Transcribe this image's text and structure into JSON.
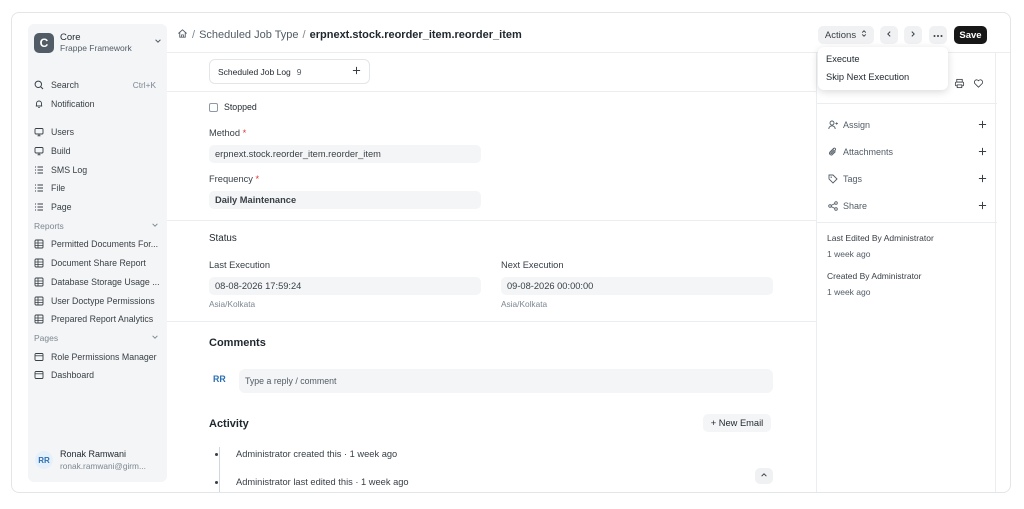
{
  "app": {
    "logo_letter": "C",
    "name": "Core",
    "subtitle": "Frappe Framework"
  },
  "sidebar": {
    "search": {
      "label": "Search",
      "shortcut": "Ctrl+K"
    },
    "notification": "Notification",
    "items": [
      "Users",
      "Build",
      "SMS Log",
      "File",
      "Page"
    ],
    "reports_heading": "Reports",
    "reports": [
      "Permitted Documents For...",
      "Document Share Report",
      "Database Storage Usage ...",
      "User Doctype Permissions",
      "Prepared Report Analytics"
    ],
    "pages_heading": "Pages",
    "pages": [
      "Role Permissions Manager",
      "Dashboard"
    ]
  },
  "user": {
    "initials": "RR",
    "name": "Ronak Ramwani",
    "email": "ronak.ramwani@girm..."
  },
  "breadcrumb": {
    "sep1": "/",
    "parent": "Scheduled Job Type",
    "sep2": "/",
    "current": "erpnext.stock.reorder_item.reorder_item"
  },
  "header": {
    "actions_label": "Actions",
    "save_label": "Save"
  },
  "actions_menu": [
    "Execute",
    "Skip Next Execution"
  ],
  "form": {
    "log_tab": {
      "label": "Scheduled Job Log",
      "count": "9"
    },
    "stopped_label": "Stopped",
    "method": {
      "label": "Method",
      "required": "*",
      "value": "erpnext.stock.reorder_item.reorder_item"
    },
    "frequency": {
      "label": "Frequency",
      "required": "*",
      "value": "Daily Maintenance"
    },
    "status_heading": "Status",
    "last_execution": {
      "label": "Last Execution",
      "value": "08-08-2026 17:59:24",
      "tz": "Asia/Kolkata"
    },
    "next_execution": {
      "label": "Next Execution",
      "value": "09-08-2026 00:00:00",
      "tz": "Asia/Kolkata"
    }
  },
  "comments": {
    "heading": "Comments",
    "initials": "RR",
    "placeholder": "Type a reply / comment"
  },
  "activity": {
    "heading": "Activity",
    "new_email": "+ New Email",
    "items": [
      "Administrator created this · 1 week ago",
      "Administrator last edited this · 1 week ago"
    ]
  },
  "right_panel": {
    "assign": "Assign",
    "attachments": "Attachments",
    "tags": "Tags",
    "share": "Share",
    "last_edited": "Last Edited By Administrator",
    "last_edited_time": "1 week ago",
    "created": "Created By Administrator",
    "created_time": "1 week ago"
  }
}
